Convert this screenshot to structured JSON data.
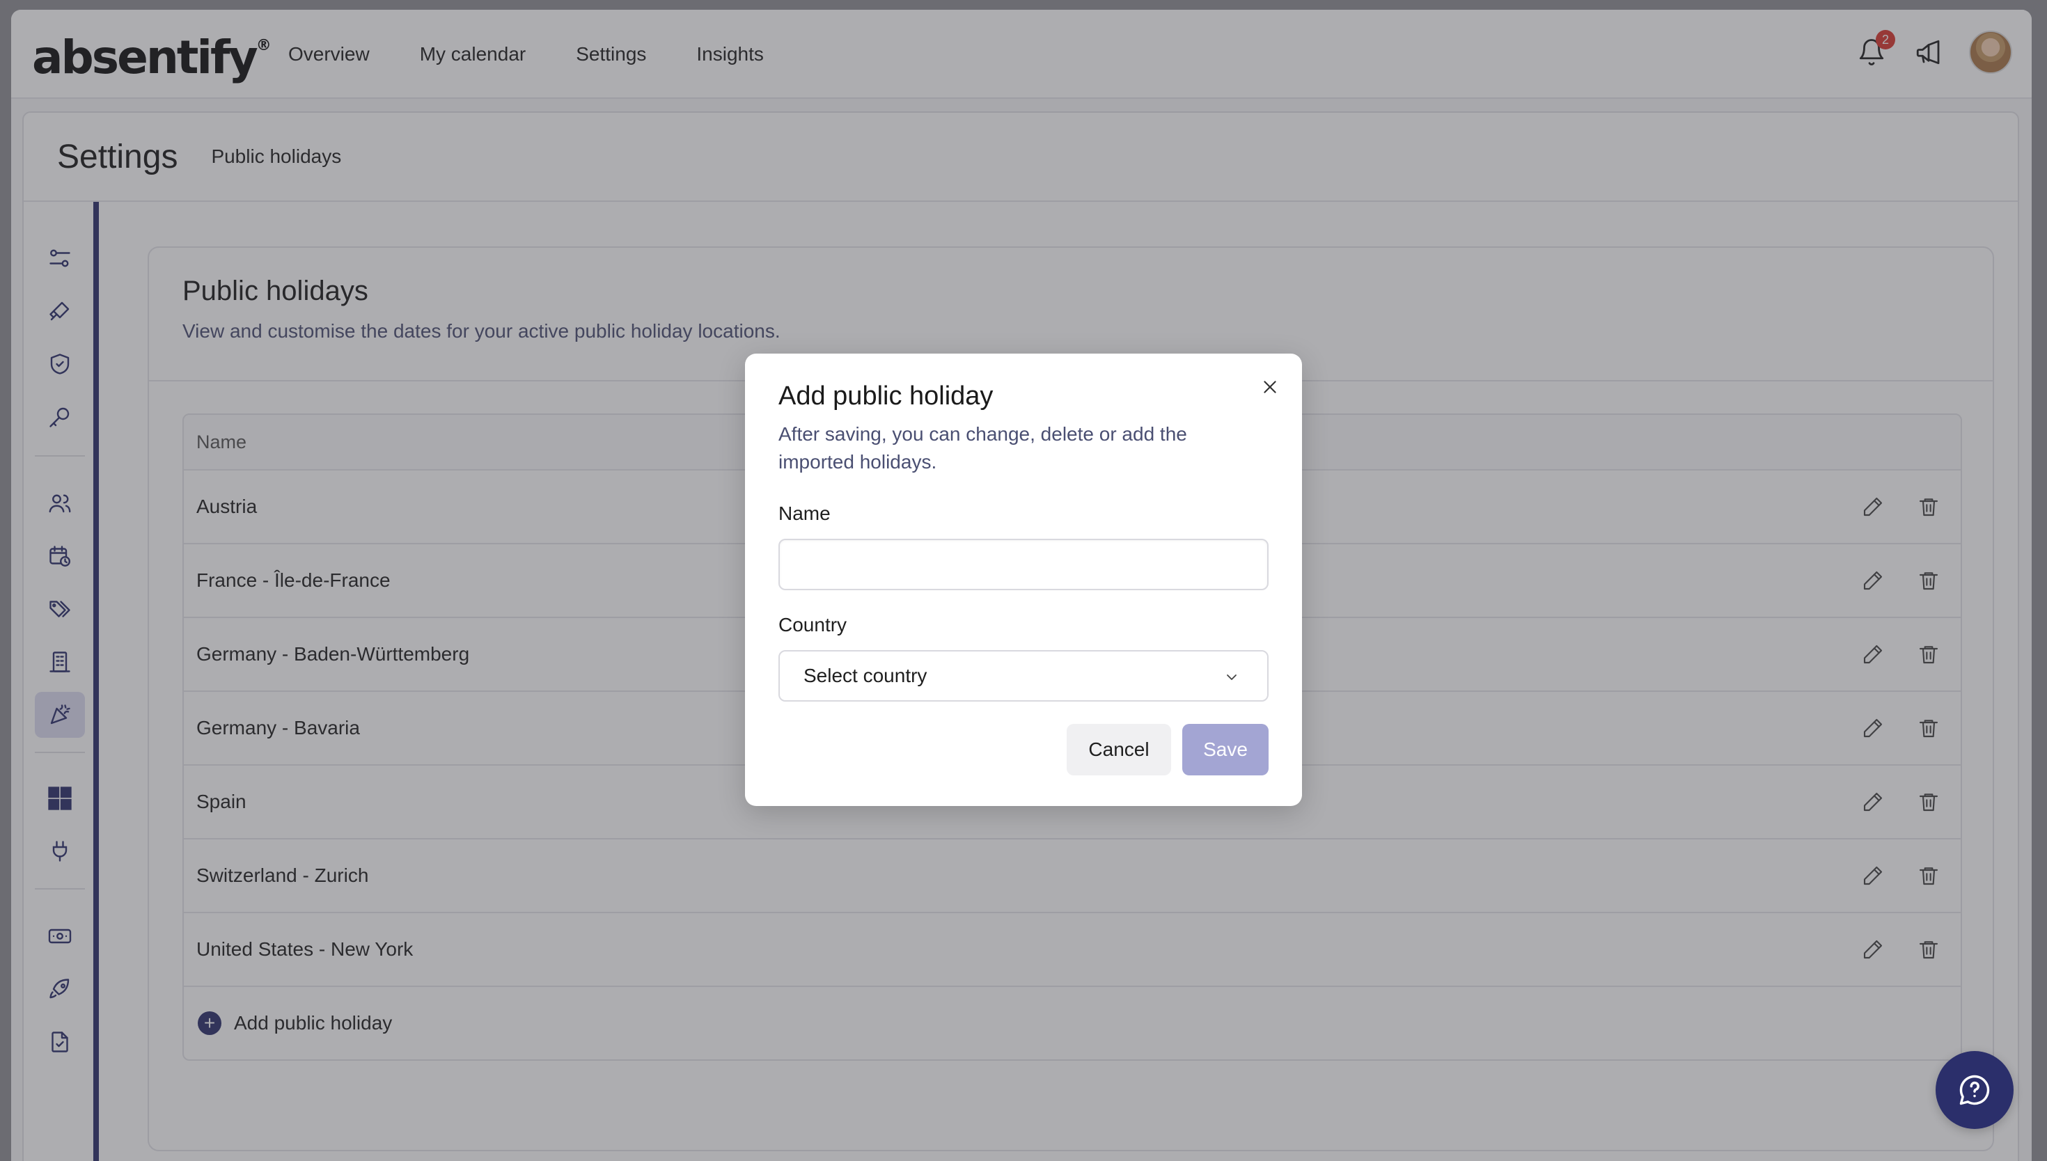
{
  "app": {
    "logo_text": "absentify",
    "logo_mark": "®"
  },
  "topnav": {
    "items": [
      {
        "label": "Overview"
      },
      {
        "label": "My calendar"
      },
      {
        "label": "Settings"
      },
      {
        "label": "Insights"
      }
    ],
    "notifications_count": "2",
    "icons": [
      "bell-icon",
      "megaphone-icon",
      "avatar"
    ]
  },
  "settings": {
    "title": "Settings",
    "breadcrumb": "Public holidays",
    "sidebar_icons": [
      "sliders-icon",
      "paintbrush-icon",
      "shield-check-icon",
      "key-icon",
      "users-icon",
      "calendar-clock-icon",
      "tags-icon",
      "building-icon",
      "party-popper-icon",
      "windows-icon",
      "plug-icon",
      "money-icon",
      "rocket-icon",
      "document-check-icon"
    ],
    "active_sidebar": "party-popper-icon"
  },
  "main": {
    "title": "Public holidays",
    "subtitle": "View and customise the dates for your active public holiday locations.",
    "table": {
      "header": "Name",
      "rows": [
        {
          "name": "Austria"
        },
        {
          "name": "France - Île-de-France"
        },
        {
          "name": "Germany - Baden-Württemberg"
        },
        {
          "name": "Germany - Bavaria"
        },
        {
          "name": "Spain"
        },
        {
          "name": "Switzerland - Zurich"
        },
        {
          "name": "United States - New York"
        }
      ],
      "add_label": "Add public holiday"
    }
  },
  "modal": {
    "title": "Add public holiday",
    "description": "After saving, you can change, delete or add the imported holidays.",
    "name_label": "Name",
    "name_value": "",
    "country_label": "Country",
    "country_value": "Select country",
    "cancel_label": "Cancel",
    "save_label": "Save"
  },
  "colors": {
    "brand": "#2b2f6b",
    "save_disabled": "#a3a5d3",
    "active_sidebar_bg": "#dcdcf2",
    "badge": "#d9372f"
  }
}
